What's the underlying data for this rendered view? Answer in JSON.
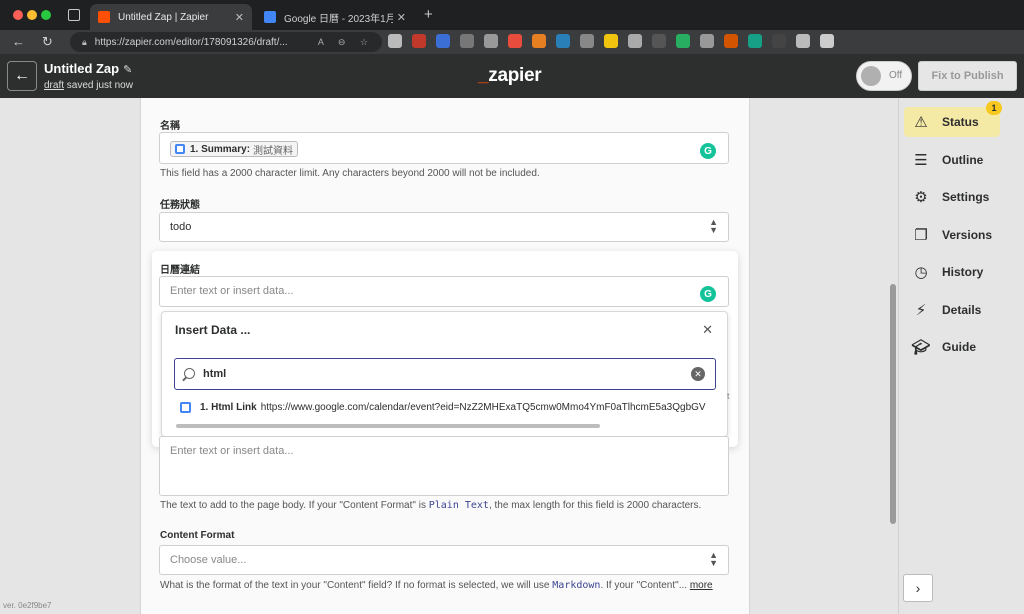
{
  "browser": {
    "tabs": [
      {
        "title": "Untitled Zap | Zapier",
        "favicon_color": "#ff4f00"
      },
      {
        "title": "Google 日曆 - 2023年1月",
        "favicon_color": "#4285f4"
      }
    ],
    "url": "https://zapier.com/editor/178091326/draft/..."
  },
  "header": {
    "title": "Untitled Zap",
    "draft_link": "draft",
    "saved_text": "saved just now",
    "logo": "zapier",
    "toggle_label": "Off",
    "publish_label": "Fix to Publish",
    "accent": "#ff4f00"
  },
  "form": {
    "name_label": "名稱",
    "name_pill_key": "1. Summary:",
    "name_pill_value": "測試資料",
    "name_help": "This field has a 2000 character limit. Any characters beyond 2000 will not be included.",
    "status_label": "任務狀態",
    "status_value": "todo",
    "calendar_label": "日曆連結",
    "calendar_placeholder": "Enter text or insert data...",
    "content_placeholder": "Enter text or insert data...",
    "content_help_pre": "The text to add to the page body. If your \"Content Format\" is",
    "content_help_code": "Plain Text",
    "content_help_post": ", the max length for this field is 2000 characters.",
    "format_label": "Content Format",
    "format_placeholder": "Choose value...",
    "format_help_pre": "What is the format of the text in your \"Content\" field? If no format is selected, we will use",
    "format_help_code": "Markdown",
    "format_help_post": ". If your \"Content\"...",
    "format_more": "more",
    "peek_right": "t"
  },
  "insert_data": {
    "title": "Insert Data ...",
    "search_value": "html",
    "result_key": "1. Html Link",
    "result_value": "https://www.google.com/calendar/event?eid=NzZ2MHExaTQ5cmw0Mmo4YmF0aTlhcmE5a3QgbGV"
  },
  "sidebar": {
    "items": [
      {
        "label": "Status",
        "icon": "warning-icon"
      },
      {
        "label": "Outline",
        "icon": "list-icon"
      },
      {
        "label": "Settings",
        "icon": "gear-icon"
      },
      {
        "label": "Versions",
        "icon": "stack-icon"
      },
      {
        "label": "History",
        "icon": "clock-icon"
      },
      {
        "label": "Details",
        "icon": "file-bolt-icon"
      },
      {
        "label": "Guide",
        "icon": "graduation-cap-icon"
      }
    ],
    "status_badge": "1",
    "active_color": "#f5e9a6"
  },
  "footer": {
    "version": "ver. 0e2f9be7"
  }
}
